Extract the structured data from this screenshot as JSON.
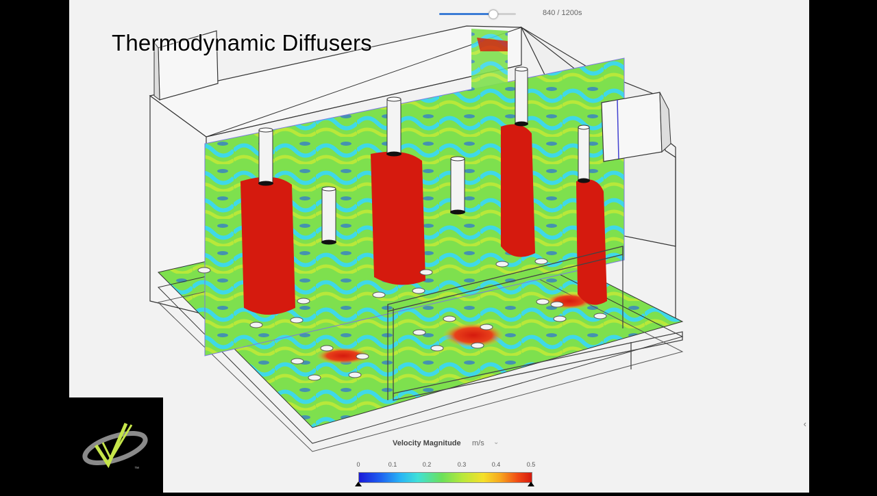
{
  "title": "Thermodynamic Diffusers",
  "timeline": {
    "current_s": 840,
    "total_s": 1200,
    "label": "840 / 1200s"
  },
  "legend": {
    "title": "Velocity Magnitude",
    "unit": "m/s",
    "ticks": [
      "0",
      "0.1",
      "0.2",
      "0.3",
      "0.4",
      "0.5"
    ],
    "min": 0,
    "max": 0.5
  },
  "icons": {
    "collapse": "chevron-left-icon",
    "logo": "checkmark-swoosh-logo",
    "logo_mark": "™"
  },
  "colors": {
    "red": "#d51a0e",
    "green": "#6be05a",
    "yellow": "#f5e02a",
    "blue": "#1e5ef0",
    "cyan": "#3fd8e8"
  }
}
